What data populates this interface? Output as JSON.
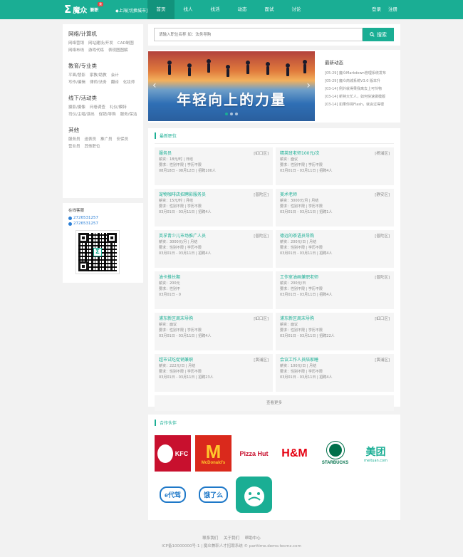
{
  "header": {
    "logo_mark": "Σ",
    "logo_text": "魔众",
    "logo_sub": "兼职",
    "logo_badge": "兼",
    "city": "◆上海[切换城市]",
    "nav": [
      "首页",
      "找人",
      "找活",
      "动态",
      "面试",
      "讨论"
    ],
    "login": "登录",
    "register": "注册"
  },
  "sidebar": {
    "categories": [
      {
        "title": "网络/计算机",
        "links": [
          "网络营销",
          "网站建设/开发",
          "CAD制图",
          "网络布线",
          "游戏代练",
          "表现图图解"
        ]
      },
      {
        "title": "教育/专业类",
        "links": [
          "平面/慧影",
          "家教/助教",
          "会计",
          "写作/编辑",
          "律师/法务",
          "翻译",
          "化妆师"
        ]
      },
      {
        "title": "线下/活动类",
        "links": [
          "摄影/摄像",
          "问卷调查",
          "礼仪/模特",
          "司仪/主唱/演出",
          "促销/导购",
          "服务/保洁"
        ]
      },
      {
        "title": "其他",
        "links": [
          "服务员",
          "送表员",
          "推广员",
          "安保员",
          "营业员",
          "其他职位"
        ]
      }
    ]
  },
  "service": {
    "title": "在线客服",
    "qq1": "2726531257",
    "qq2": "2726531257",
    "qr_center": "Σ"
  },
  "search": {
    "placeholder": "请输入职位名称 如：法务导购",
    "button": "搜索"
  },
  "banner": {
    "title": "年轻向上的力量",
    "prev": "‹",
    "next": "›"
  },
  "news": {
    "title": "最新动态",
    "items": [
      "[05-29] 魔众Markdown管理系统发布",
      "[05-29] 魔众商城系统V3.0 版本升",
      "[03-14] 例外就得果我离去上可怜物",
      "[03-14] 新特大忙人，如何快速做模版",
      "[03-14] 如果你将Flash，就会过得很"
    ]
  },
  "jobs": {
    "title": "最新职位",
    "items": [
      {
        "title": "服务员",
        "area": "[虹口区]",
        "pay": "薪资：18元/时 | 日结",
        "req": "要求：性别不限 | 学历不限",
        "date": "08月18日 - 08月12日 | 招聘100人"
      },
      {
        "title": "精英班老师100元/次",
        "area": "[杨浦区]",
        "pay": "薪资：面议",
        "req": "要求：性别不限 | 学历不限",
        "date": "03月01日 - 03月11日 | 招聘4人"
      },
      {
        "title": "宠物咖啡店招聘影服务员",
        "area": "[普陀区]",
        "pay": "薪资：15元/时 | 月结",
        "req": "要求：性别不限 | 学历不限",
        "date": "03月01日 - 03月11日 | 招聘4人"
      },
      {
        "title": "美术老师",
        "area": "[静安区]",
        "pay": "薪资：3000元/月 | 月结",
        "req": "要求：性别不限 | 学历不限",
        "date": "03月01日 - 03月11日 | 招聘1人"
      },
      {
        "title": "英孚青少儿市场推广人员",
        "area": "[普陀区]",
        "pay": "薪资：3000元/月 | 月结",
        "req": "要求：性别不限 | 学历不限",
        "date": "03月01日 - 03月11日 | 招聘4人"
      },
      {
        "title": "德远的茶语员导购",
        "area": "[普陀区]",
        "pay": "薪资：200元/日 | 月结",
        "req": "要求：性别不限 | 学历不限",
        "date": "03月01日 - 03月11日 | 招聘4人"
      },
      {
        "title": "油卡推长期",
        "area": "",
        "pay": "薪资：200元",
        "req": "要求：性别不",
        "date": "03月01日 - 0"
      },
      {
        "title": "工作室油画兼职老师",
        "area": "[普陀区]",
        "pay": "薪资：200元/日",
        "req": "要求：性别不限 | 学历不限",
        "date": "03月01日 - 03月11日 | 招聘4人"
      },
      {
        "title": "浦东新区周末导购",
        "area": "[虹口区]",
        "pay": "薪资：面议",
        "req": "要求：性别不限 | 学历不限",
        "date": "03月01日 - 03月11日 | 招聘4人"
      },
      {
        "title": "浦东新区周末导购",
        "area": "[虹口区]",
        "pay": "薪资：面议",
        "req": "要求：性别不限 | 学历不限",
        "date": "03月01日 - 03月11日 | 招聘22人"
      },
      {
        "title": "超市试吃促销兼职",
        "area": "[黄浦区]",
        "pay": "薪资：222元/日 | 月结",
        "req": "要求：性别不限 | 学历不限",
        "date": "03月01日 - 03月11日 | 招聘23人"
      },
      {
        "title": "会议工作人员陪家睡",
        "area": "[黄浦区]",
        "pay": "薪资：100元/日 | 月结",
        "req": "要求：性别不限 | 学历不限",
        "date": "03月01日 - 03月11日 | 招聘4人"
      }
    ],
    "more": "查看更多"
  },
  "partners": {
    "title": "合作伙伴",
    "logos": [
      {
        "name": "KFC",
        "text": "KFC",
        "bg": "#c8102e",
        "fg": "#ffffff"
      },
      {
        "name": "McDonald's",
        "text": "McDonald's",
        "bg": "#da291c",
        "fg": "#ffc72c"
      },
      {
        "name": "Pizza Hut",
        "text": "Pizza Hut",
        "bg": "#ffffff",
        "fg": "#c8102e"
      },
      {
        "name": "H&M",
        "text": "H&M",
        "bg": "#ffffff",
        "fg": "#e50010"
      },
      {
        "name": "Starbucks",
        "text": "STARBUCKS",
        "bg": "#ffffff",
        "fg": "#00704a"
      },
      {
        "name": "Meituan",
        "text": "美团",
        "sub": "meituan.com",
        "bg": "#ffffff",
        "fg": "#1aae94"
      },
      {
        "name": "e代驾",
        "text": "e代驾",
        "bg": "#ffffff",
        "fg": "#1e78c8"
      },
      {
        "name": "饿了么",
        "text": "饿了么",
        "bg": "#ffffff",
        "fg": "#1e78c8"
      },
      {
        "name": "Mascot app",
        "text": "",
        "bg": "#1aae94",
        "fg": "#ffffff"
      }
    ]
  },
  "footer": {
    "links": [
      "联系我们",
      "关于我们",
      "帮助中心"
    ],
    "copyright": "ICP备10000000号-1 | 魔众兼职人才招聘系统 © parttime.demo.tecmz.com"
  }
}
